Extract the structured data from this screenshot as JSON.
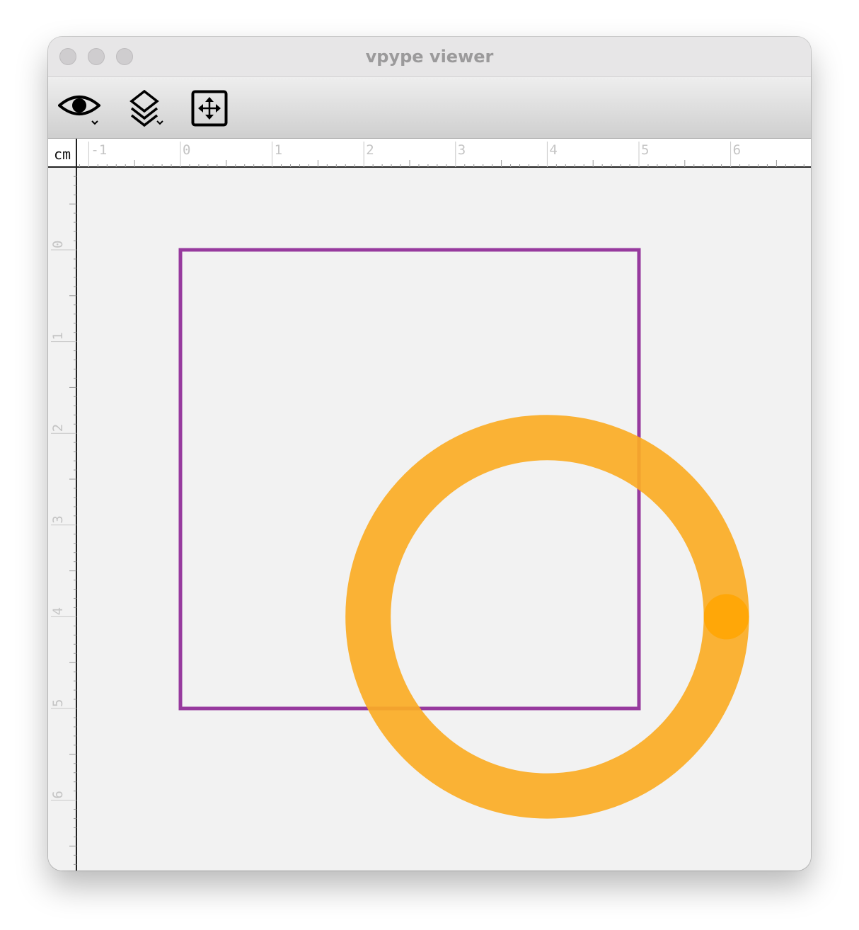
{
  "window": {
    "title": "vpype viewer"
  },
  "toolbar": {
    "view_icon": "eye-icon",
    "layers_icon": "layers-icon",
    "fit_icon": "fit-to-page-icon"
  },
  "ruler": {
    "unit": "cm",
    "h_labels": [
      "-1",
      "0",
      "1",
      "2",
      "3",
      "4",
      "5",
      "6"
    ],
    "v_labels": [
      "0",
      "1",
      "2",
      "3",
      "4",
      "5",
      "6"
    ]
  },
  "canvas": {
    "background": "#f2f2f2",
    "shapes": [
      {
        "type": "rect",
        "layer_color": "#8f2a97",
        "x": [
          0,
          5
        ],
        "y": [
          0,
          5
        ],
        "unit": "cm"
      },
      {
        "type": "circle",
        "layer_color": "#fbac25",
        "center": [
          4,
          4
        ],
        "radius": 2,
        "unit": "cm"
      }
    ],
    "pen_dot_color": "#ffa500"
  }
}
